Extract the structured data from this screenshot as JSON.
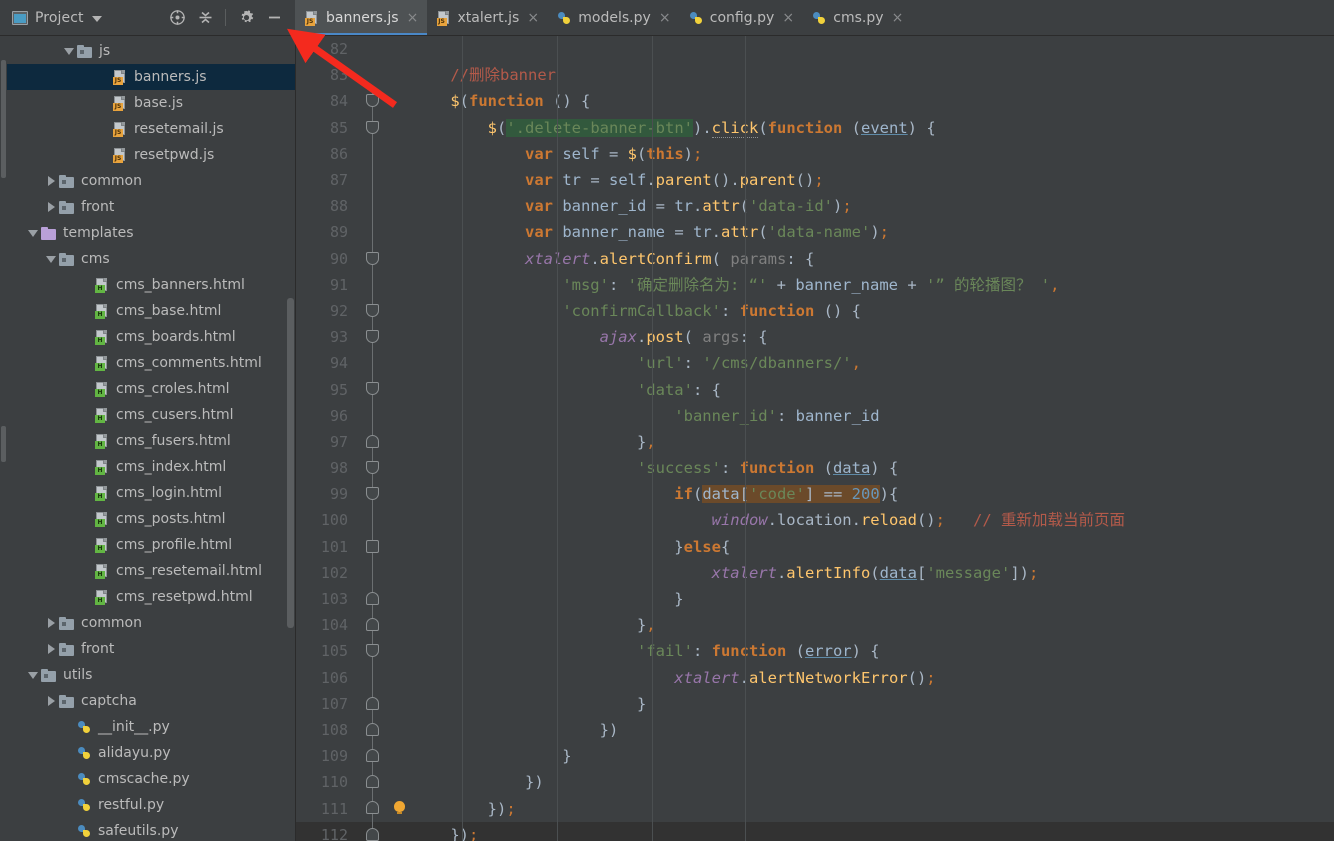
{
  "window": {
    "theme_bg": "#3c3f41",
    "editor_bg": "#3c3f41",
    "accent": "#4a88c7"
  },
  "project_panel": {
    "title": "Project",
    "icons": [
      {
        "name": "locate-icon",
        "glyph": "locate"
      },
      {
        "name": "collapse-all-icon",
        "glyph": "collapse"
      },
      {
        "name": "settings-gear-icon",
        "glyph": "gear"
      },
      {
        "name": "hide-panel-icon",
        "glyph": "minus"
      }
    ],
    "tree": [
      {
        "label": "js",
        "type": "folder",
        "expanded": true,
        "indent": 3,
        "selected": false
      },
      {
        "label": "banners.js",
        "type": "js",
        "indent": 5,
        "selected": true
      },
      {
        "label": "base.js",
        "type": "js",
        "indent": 5,
        "selected": false
      },
      {
        "label": "resetemail.js",
        "type": "js",
        "indent": 5,
        "selected": false
      },
      {
        "label": "resetpwd.js",
        "type": "js",
        "indent": 5,
        "selected": false
      },
      {
        "label": "common",
        "type": "folder",
        "expanded": false,
        "indent": 2,
        "selected": false
      },
      {
        "label": "front",
        "type": "folder",
        "expanded": false,
        "indent": 2,
        "selected": false
      },
      {
        "label": "templates",
        "type": "folder-purple",
        "expanded": true,
        "indent": 1,
        "selected": false
      },
      {
        "label": "cms",
        "type": "folder",
        "expanded": true,
        "indent": 2,
        "selected": false
      },
      {
        "label": "cms_banners.html",
        "type": "html",
        "indent": 4,
        "selected": false
      },
      {
        "label": "cms_base.html",
        "type": "html",
        "indent": 4,
        "selected": false
      },
      {
        "label": "cms_boards.html",
        "type": "html",
        "indent": 4,
        "selected": false
      },
      {
        "label": "cms_comments.html",
        "type": "html",
        "indent": 4,
        "selected": false
      },
      {
        "label": "cms_croles.html",
        "type": "html",
        "indent": 4,
        "selected": false
      },
      {
        "label": "cms_cusers.html",
        "type": "html",
        "indent": 4,
        "selected": false
      },
      {
        "label": "cms_fusers.html",
        "type": "html",
        "indent": 4,
        "selected": false
      },
      {
        "label": "cms_index.html",
        "type": "html",
        "indent": 4,
        "selected": false
      },
      {
        "label": "cms_login.html",
        "type": "html",
        "indent": 4,
        "selected": false
      },
      {
        "label": "cms_posts.html",
        "type": "html",
        "indent": 4,
        "selected": false
      },
      {
        "label": "cms_profile.html",
        "type": "html",
        "indent": 4,
        "selected": false
      },
      {
        "label": "cms_resetemail.html",
        "type": "html",
        "indent": 4,
        "selected": false
      },
      {
        "label": "cms_resetpwd.html",
        "type": "html",
        "indent": 4,
        "selected": false
      },
      {
        "label": "common",
        "type": "folder",
        "expanded": false,
        "indent": 2,
        "selected": false
      },
      {
        "label": "front",
        "type": "folder",
        "expanded": false,
        "indent": 2,
        "selected": false
      },
      {
        "label": "utils",
        "type": "folder",
        "expanded": true,
        "indent": 1,
        "selected": false
      },
      {
        "label": "captcha",
        "type": "folder",
        "expanded": false,
        "indent": 2,
        "selected": false
      },
      {
        "label": "__init__.py",
        "type": "py",
        "indent": 3,
        "selected": false
      },
      {
        "label": "alidayu.py",
        "type": "py",
        "indent": 3,
        "selected": false
      },
      {
        "label": "cmscache.py",
        "type": "py",
        "indent": 3,
        "selected": false
      },
      {
        "label": "restful.py",
        "type": "py",
        "indent": 3,
        "selected": false
      },
      {
        "label": "safeutils.py",
        "type": "py",
        "indent": 3,
        "selected": false
      }
    ]
  },
  "tabs": [
    {
      "label": "banners.js",
      "type": "js",
      "active": true,
      "close": "×"
    },
    {
      "label": "xtalert.js",
      "type": "js",
      "active": false,
      "close": "×"
    },
    {
      "label": "models.py",
      "type": "py",
      "active": false,
      "close": "×"
    },
    {
      "label": "config.py",
      "type": "py",
      "active": false,
      "close": "×"
    },
    {
      "label": "cms.py",
      "type": "py",
      "active": false,
      "close": "×"
    }
  ],
  "editor": {
    "language": "javascript",
    "first_visible_line": 82,
    "current_line": 112,
    "bulb_line": 111,
    "lines": [
      {
        "n": "82",
        "fold": "none",
        "text": ""
      },
      {
        "n": "83",
        "fold": "none",
        "text": "    //删除banner"
      },
      {
        "n": "84",
        "fold": "open",
        "text": "    $(function () {"
      },
      {
        "n": "85",
        "fold": "open",
        "text": "        $('.delete-banner-btn').click(function (event) {"
      },
      {
        "n": "86",
        "fold": "none",
        "text": "            var self = $(this);"
      },
      {
        "n": "87",
        "fold": "none",
        "text": "            var tr = self.parent().parent();"
      },
      {
        "n": "88",
        "fold": "none",
        "text": "            var banner_id = tr.attr('data-id');"
      },
      {
        "n": "89",
        "fold": "none",
        "text": "            var banner_name = tr.attr('data-name');"
      },
      {
        "n": "90",
        "fold": "open",
        "text": "            xtalert.alertConfirm( params: {"
      },
      {
        "n": "91",
        "fold": "none",
        "text": "                'msg': '确定删除名为: “' + banner_name + '” 的轮播图？ ',"
      },
      {
        "n": "92",
        "fold": "open",
        "text": "                'confirmCallback': function () {"
      },
      {
        "n": "93",
        "fold": "open",
        "text": "                    ajax.post( args: {"
      },
      {
        "n": "94",
        "fold": "none",
        "text": "                        'url': '/cms/dbanners/',"
      },
      {
        "n": "95",
        "fold": "open",
        "text": "                        'data': {"
      },
      {
        "n": "96",
        "fold": "none",
        "text": "                            'banner_id': banner_id"
      },
      {
        "n": "97",
        "fold": "end",
        "text": "                        },"
      },
      {
        "n": "98",
        "fold": "open",
        "text": "                        'success': function (data) {"
      },
      {
        "n": "99",
        "fold": "open",
        "text": "                            if(data['code'] == 200){"
      },
      {
        "n": "100",
        "fold": "none",
        "text": "                                window.location.reload();   // 重新加载当前页面"
      },
      {
        "n": "101",
        "fold": "mid",
        "text": "                            }else{"
      },
      {
        "n": "102",
        "fold": "none",
        "text": "                                xtalert.alertInfo(data['message']);"
      },
      {
        "n": "103",
        "fold": "end",
        "text": "                            }"
      },
      {
        "n": "104",
        "fold": "end",
        "text": "                        },"
      },
      {
        "n": "105",
        "fold": "open",
        "text": "                        'fail': function (error) {"
      },
      {
        "n": "106",
        "fold": "none",
        "text": "                            xtalert.alertNetworkError();"
      },
      {
        "n": "107",
        "fold": "end",
        "text": "                        }"
      },
      {
        "n": "108",
        "fold": "end",
        "text": "                    })"
      },
      {
        "n": "109",
        "fold": "end",
        "text": "                }"
      },
      {
        "n": "110",
        "fold": "end",
        "text": "            })"
      },
      {
        "n": "111",
        "fold": "end",
        "text": "        });"
      },
      {
        "n": "112",
        "fold": "end",
        "text": "    });"
      }
    ]
  },
  "annotation": {
    "type": "red-arrow",
    "color": "#f03030",
    "points_to": "banners.js tab"
  }
}
